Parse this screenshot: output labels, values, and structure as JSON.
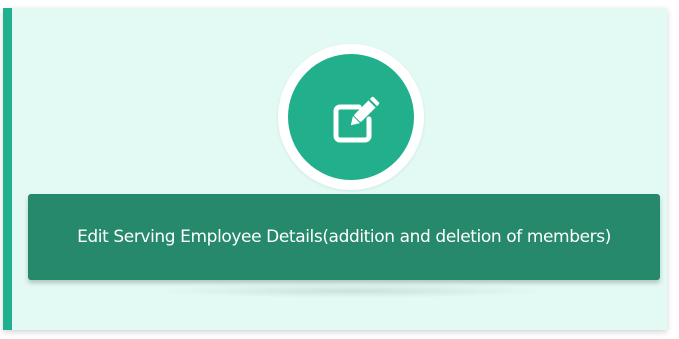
{
  "card": {
    "label": "Edit Serving Employee Details(addition and deletion of members)",
    "icon": "edit-icon",
    "accent_color": "#1fb08f",
    "button_color": "#26896c",
    "background_color": "#e3faf4"
  }
}
